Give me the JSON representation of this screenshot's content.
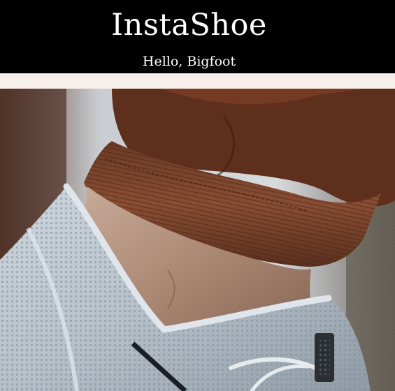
{
  "header": {
    "brand": "InstaShoe",
    "greeting": "Hello, Bigfoot"
  },
  "colors": {
    "header_bg": "#000000",
    "header_text": "#ffffff",
    "band": "#f7efe9"
  },
  "hero": {
    "subject": "close-up of a sneaker heel below a rolled brown pant cuff"
  }
}
